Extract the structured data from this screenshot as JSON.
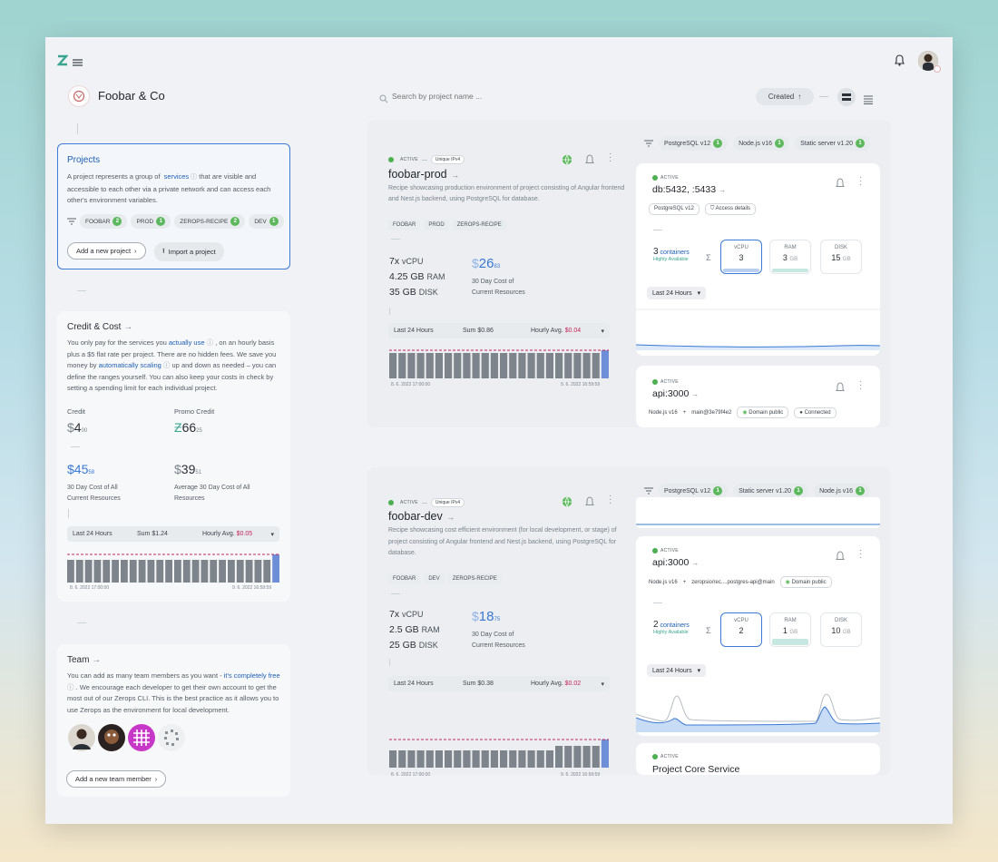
{
  "org": {
    "name": "Foobar & Co"
  },
  "search": {
    "placeholder": "Search by project name ..."
  },
  "sort": {
    "label": "Created"
  },
  "projects_card": {
    "title": "Projects",
    "text_1": "A project represents a group of",
    "services_link": "services",
    "text_2": "that are visible and accessible to each other via a private network and can access each other's environment variables.",
    "tags": [
      {
        "label": "FOOBAR",
        "count": "2"
      },
      {
        "label": "PROD",
        "count": "1"
      },
      {
        "label": "ZEROPS-RECIPE",
        "count": "2"
      },
      {
        "label": "DEV",
        "count": "1"
      }
    ],
    "add_button": "Add a new project",
    "import_button": "Import a project"
  },
  "credit_card": {
    "title": "Credit & Cost",
    "text_1": "You only pay for the services you",
    "actually_use": "actually use",
    "text_2": ", on an hourly basis plus a $5 flat rate per project. There are no hidden fees. We save you money by",
    "auto_scaling": "automatically scaling",
    "text_3": "up and down as needed – you can define the ranges yourself. You can also keep your costs in check by setting a spending limit for each individual project.",
    "credit_label": "Credit",
    "credit_cur": "$",
    "credit_int": "4",
    "credit_dec": "00",
    "promo_label": "Promo Credit",
    "promo_cur": "Ƶ",
    "promo_int": "66",
    "promo_dec": "25",
    "cost30_cur": "$",
    "cost30_int": "45",
    "cost30_dec": "58",
    "cost30_label": "30 Day Cost of All Current Resources",
    "avg30_cur": "$",
    "avg30_int": "39",
    "avg30_dec": "51",
    "avg30_label": "Average 30 Day Cost of All Resources",
    "range": "Last 24 Hours",
    "sum": "Sum $1.24",
    "hourly_label": "Hourly Avg.",
    "hourly_value": "$0.05",
    "date_start": "8. 6. 2022 17:00:00",
    "date_end": "9. 6. 2022 16:59:59"
  },
  "team_card": {
    "title": "Team",
    "text_1": "You can add as many team members as you want -",
    "free_link": "it's completely free",
    "text_2": ". We encourage each developer to get their own account to get the most out of our Zerops CLI. This is the best practice as it allows you to use Zerops as the environment for local development.",
    "add_button": "Add a new team member"
  },
  "prod": {
    "status": "ACTIVE",
    "ipv4": "Unique IPv4",
    "name": "foobar-prod",
    "desc": "Recipe showcasing production environment of project consisting of Angular frontend and Nest.js backend, using PostgreSQL for database.",
    "tags": [
      "FOOBAR",
      "PROD",
      "ZEROPS-RECIPE"
    ],
    "vcpu": "7x",
    "vcpu_label": "vCPU",
    "ram": "4.25 GB",
    "ram_label": "RAM",
    "disk": "35 GB",
    "disk_label": "DISK",
    "cost_cur": "$",
    "cost_int": "26",
    "cost_dec": "83",
    "cost_label": "30 Day Cost of Current Resources",
    "range": "Last 24 Hours",
    "sum": "Sum $0.86",
    "hourly_label": "Hourly Avg.",
    "hourly_value": "$0.04",
    "date_start": "8. 6. 2022 17:00:00",
    "date_end": "9. 6. 2022 16:59:59",
    "filters": [
      {
        "label": "PostgreSQL v12",
        "count": "1"
      },
      {
        "label": "Node.js v16",
        "count": "1"
      },
      {
        "label": "Static server v1.20",
        "count": "1"
      }
    ],
    "svc_db": {
      "status": "ACTIVE",
      "name": "db:5432, :5433",
      "type": "PostgreSQL v12",
      "access": "Access details",
      "containers_n": "3",
      "containers_label": "containers",
      "ha": "Highly Available",
      "vcpu_label": "vCPU",
      "vcpu": "3",
      "ram_label": "RAM",
      "ram": "3",
      "ram_unit": "GB",
      "disk_label": "DISK",
      "disk": "15",
      "disk_unit": "GB",
      "range": "Last 24 Hours"
    },
    "svc_api": {
      "status": "ACTIVE",
      "name": "api:3000",
      "type": "Node.js v16",
      "branch": "main@3e79f4e2",
      "domain": "Domain public",
      "connected": "Connected"
    }
  },
  "dev": {
    "status": "ACTIVE",
    "ipv4": "Unique IPv4",
    "name": "foobar-dev",
    "desc": "Recipe showcasing cost efficient environment (for local development, or stage) of project consisting of Angular frontend and Nest.js backend, using PostgreSQL for database.",
    "tags": [
      "FOOBAR",
      "DEV",
      "ZEROPS-RECIPE"
    ],
    "vcpu": "7x",
    "vcpu_label": "vCPU",
    "ram": "2.5 GB",
    "ram_label": "RAM",
    "disk": "25 GB",
    "disk_label": "DISK",
    "cost_cur": "$",
    "cost_int": "18",
    "cost_dec": "75",
    "cost_label": "30 Day Cost of Current Resources",
    "range": "Last 24 Hours",
    "sum": "Sum $0.38",
    "hourly_label": "Hourly Avg.",
    "hourly_value": "$0.02",
    "date_start": "8. 6. 2022 17:00:00",
    "date_end": "9. 6. 2022 16:59:59",
    "filters": [
      {
        "label": "PostgreSQL v12",
        "count": "1"
      },
      {
        "label": "Static server v1.20",
        "count": "1"
      },
      {
        "label": "Node.js v16",
        "count": "1"
      }
    ],
    "svc_api": {
      "status": "ACTIVE",
      "name": "api:3000",
      "type": "Node.js v16",
      "branch": "zeropsio/rec....postgres-api@main",
      "domain": "Domain public",
      "containers_n": "2",
      "containers_label": "containers",
      "ha": "Highly Available",
      "vcpu_label": "vCPU",
      "vcpu": "2",
      "ram_label": "RAM",
      "ram": "1",
      "ram_unit": "GB",
      "disk_label": "DISK",
      "disk": "10",
      "disk_unit": "GB",
      "range": "Last 24 Hours"
    },
    "svc_core": {
      "status": "ACTIVE",
      "name": "Project Core Service"
    }
  },
  "colors": {
    "accent": "#1e5fb4",
    "active": "#4caf50",
    "cost_red": "#c4285a",
    "bar": "#7e848b",
    "bar_last": "#6e8fd8"
  }
}
